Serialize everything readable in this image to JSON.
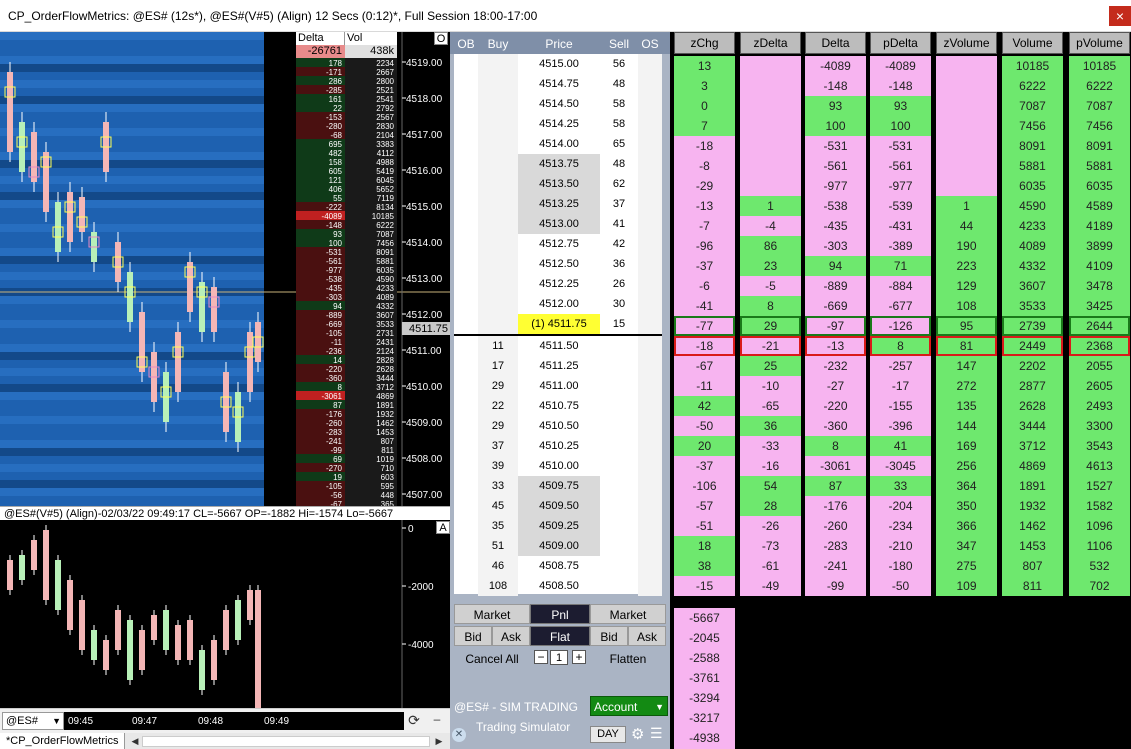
{
  "window": {
    "title": "CP_OrderFlowMetrics: @ES# (12s*), @ES#(V#5) (Align) 12 Secs (0:12)*, Full Session 18:00-17:00",
    "close": "×"
  },
  "chart": {
    "o_button": "O",
    "a_button": "A",
    "price_axis": [
      "4519.00",
      "4518.00",
      "4517.00",
      "4516.00",
      "4515.00",
      "4514.00",
      "4513.00",
      "4512.00",
      "4511.00",
      "4510.00",
      "4509.00",
      "4508.00",
      "4507.00"
    ],
    "current_price": "4511.75",
    "delta_header": "Delta",
    "vol_header": "Vol",
    "delta_total": "-26761",
    "vol_total": "438k",
    "profile": [
      [
        "178",
        "2234"
      ],
      [
        "-171",
        "2667"
      ],
      [
        "286",
        "2800"
      ],
      [
        "-285",
        "2521"
      ],
      [
        "161",
        "2541"
      ],
      [
        "22",
        "2792"
      ],
      [
        "-153",
        "2567"
      ],
      [
        "-280",
        "2830"
      ],
      [
        "-68",
        "2104"
      ],
      [
        "695",
        "3383"
      ],
      [
        "482",
        "4112"
      ],
      [
        "158",
        "4988"
      ],
      [
        "605",
        "5419"
      ],
      [
        "121",
        "6045"
      ],
      [
        "406",
        "5652"
      ],
      [
        "55",
        "7119"
      ],
      [
        "-222",
        "8134"
      ],
      [
        "-4089",
        "10185"
      ],
      [
        "-148",
        "6222"
      ],
      [
        "93",
        "7087"
      ],
      [
        "100",
        "7456"
      ],
      [
        "-531",
        "8091"
      ],
      [
        "-561",
        "5881"
      ],
      [
        "-977",
        "6035"
      ],
      [
        "-538",
        "4590"
      ],
      [
        "-435",
        "4233"
      ],
      [
        "-303",
        "4089"
      ],
      [
        "94",
        "4332"
      ],
      [
        "-889",
        "3607"
      ],
      [
        "-669",
        "3533"
      ],
      [
        "-105",
        "2731"
      ],
      [
        "-11",
        "2431"
      ],
      [
        "-236",
        "2124"
      ],
      [
        "14",
        "2828"
      ],
      [
        "-220",
        "2628"
      ],
      [
        "-360",
        "3444"
      ],
      [
        "8",
        "3712"
      ],
      [
        "-3061",
        "4869"
      ],
      [
        "87",
        "1891"
      ],
      [
        "-176",
        "1932"
      ],
      [
        "-260",
        "1462"
      ],
      [
        "-283",
        "1453"
      ],
      [
        "-241",
        "807"
      ],
      [
        "-99",
        "811"
      ],
      [
        "69",
        "1019"
      ],
      [
        "-270",
        "710"
      ],
      [
        "19",
        "603"
      ],
      [
        "-105",
        "595"
      ],
      [
        "-56",
        "448"
      ],
      [
        "-67",
        "365"
      ]
    ],
    "ind_info": "@ES#(V#5) (Align)-02/03/22 09:49:17 CL=-5667 OP=-1882 Hi=-1574 Lo=-5667",
    "ind_axis": [
      "0",
      "-2000",
      "-4000"
    ],
    "ind_value": "-5667",
    "symbol": "@ES#",
    "times": [
      "09:45",
      "09:47",
      "09:48",
      "09:49"
    ],
    "tab": "*CP_OrderFlowMetrics"
  },
  "dom": {
    "headers": [
      "OB",
      "Buy",
      "Price",
      "Sell",
      "OS"
    ],
    "rows": [
      {
        "buy": "",
        "price": "4515.00",
        "sell": "56"
      },
      {
        "buy": "",
        "price": "4514.75",
        "sell": "48"
      },
      {
        "buy": "",
        "price": "4514.50",
        "sell": "58"
      },
      {
        "buy": "",
        "price": "4514.25",
        "sell": "58"
      },
      {
        "buy": "",
        "price": "4514.00",
        "sell": "65"
      },
      {
        "buy": "",
        "price": "4513.75",
        "sell": "48"
      },
      {
        "buy": "",
        "price": "4513.50",
        "sell": "62"
      },
      {
        "buy": "",
        "price": "4513.25",
        "sell": "37"
      },
      {
        "buy": "",
        "price": "4513.00",
        "sell": "41"
      },
      {
        "buy": "",
        "price": "4512.75",
        "sell": "42"
      },
      {
        "buy": "",
        "price": "4512.50",
        "sell": "36"
      },
      {
        "buy": "",
        "price": "4512.25",
        "sell": "26"
      },
      {
        "buy": "",
        "price": "4512.00",
        "sell": "30"
      },
      {
        "buy": "",
        "price": "(1) 4511.75",
        "sell": "15"
      },
      {
        "buy": "11",
        "price": "4511.50",
        "sell": ""
      },
      {
        "buy": "17",
        "price": "4511.25",
        "sell": ""
      },
      {
        "buy": "29",
        "price": "4511.00",
        "sell": ""
      },
      {
        "buy": "22",
        "price": "4510.75",
        "sell": ""
      },
      {
        "buy": "29",
        "price": "4510.50",
        "sell": ""
      },
      {
        "buy": "37",
        "price": "4510.25",
        "sell": ""
      },
      {
        "buy": "39",
        "price": "4510.00",
        "sell": ""
      },
      {
        "buy": "33",
        "price": "4509.75",
        "sell": ""
      },
      {
        "buy": "45",
        "price": "4509.50",
        "sell": ""
      },
      {
        "buy": "35",
        "price": "4509.25",
        "sell": ""
      },
      {
        "buy": "51",
        "price": "4509.00",
        "sell": ""
      },
      {
        "buy": "46",
        "price": "4508.75",
        "sell": ""
      },
      {
        "buy": "108",
        "price": "4508.50",
        "sell": ""
      }
    ],
    "controls": {
      "market": "Market",
      "pnl": "Pnl",
      "bid": "Bid",
      "ask": "Ask",
      "flat": "Flat",
      "cancel_all": "Cancel All",
      "qty": "1",
      "flatten": "Flatten",
      "account_line1": "@ES# - SIM TRADING",
      "account_line2": "Trading Simulator",
      "account_select": "Account",
      "day": "DAY"
    }
  },
  "metrics": {
    "headers": [
      "zChg",
      "zDelta",
      "Delta",
      "pDelta",
      "zVolume",
      "Volume",
      "pVolume"
    ],
    "rows": [
      [
        "13",
        "",
        "-4089",
        "-4089",
        "",
        "10185",
        "10185"
      ],
      [
        "3",
        "",
        "-148",
        "-148",
        "",
        "6222",
        "6222"
      ],
      [
        "0",
        "",
        "93",
        "93",
        "",
        "7087",
        "7087"
      ],
      [
        "7",
        "",
        "100",
        "100",
        "",
        "7456",
        "7456"
      ],
      [
        "-18",
        "",
        "-531",
        "-531",
        "",
        "8091",
        "8091"
      ],
      [
        "-8",
        "",
        "-561",
        "-561",
        "",
        "5881",
        "5881"
      ],
      [
        "-29",
        "",
        "-977",
        "-977",
        "",
        "6035",
        "6035"
      ],
      [
        "-13",
        "1",
        "-538",
        "-539",
        "1",
        "4590",
        "4589"
      ],
      [
        "-7",
        "-4",
        "-435",
        "-431",
        "44",
        "4233",
        "4189"
      ],
      [
        "-96",
        "86",
        "-303",
        "-389",
        "190",
        "4089",
        "3899"
      ],
      [
        "-37",
        "23",
        "94",
        "71",
        "223",
        "4332",
        "4109"
      ],
      [
        "-6",
        "-5",
        "-889",
        "-884",
        "129",
        "3607",
        "3478"
      ],
      [
        "-41",
        "8",
        "-669",
        "-677",
        "108",
        "3533",
        "3425"
      ],
      [
        "-77",
        "29",
        "-97",
        "-126",
        "95",
        "2739",
        "2644"
      ],
      [
        "-18",
        "-21",
        "-13",
        "8",
        "81",
        "2449",
        "2368"
      ],
      [
        "-67",
        "25",
        "-232",
        "-257",
        "147",
        "2202",
        "2055"
      ],
      [
        "-11",
        "-10",
        "-27",
        "-17",
        "272",
        "2877",
        "2605"
      ],
      [
        "42",
        "-65",
        "-220",
        "-155",
        "135",
        "2628",
        "2493"
      ],
      [
        "-50",
        "36",
        "-360",
        "-396",
        "144",
        "3444",
        "3300"
      ],
      [
        "20",
        "-33",
        "8",
        "41",
        "169",
        "3712",
        "3543"
      ],
      [
        "-37",
        "-16",
        "-3061",
        "-3045",
        "256",
        "4869",
        "4613"
      ],
      [
        "-106",
        "54",
        "87",
        "33",
        "364",
        "1891",
        "1527"
      ],
      [
        "-57",
        "28",
        "-176",
        "-204",
        "350",
        "1932",
        "1582"
      ],
      [
        "-51",
        "-26",
        "-260",
        "-234",
        "366",
        "1462",
        "1096"
      ],
      [
        "18",
        "-73",
        "-283",
        "-210",
        "347",
        "1453",
        "1106"
      ],
      [
        "38",
        "-61",
        "-241",
        "-180",
        "275",
        "807",
        "532"
      ],
      [
        "-15",
        "-49",
        "-99",
        "-50",
        "109",
        "811",
        "702"
      ]
    ],
    "cumulative": [
      "-5667",
      "-2045",
      "-2588",
      "-3761",
      "-3294",
      "-3217",
      "-4938"
    ],
    "colors": {
      "positive": "#6ee86e",
      "negative": "#f7b4f0"
    }
  }
}
